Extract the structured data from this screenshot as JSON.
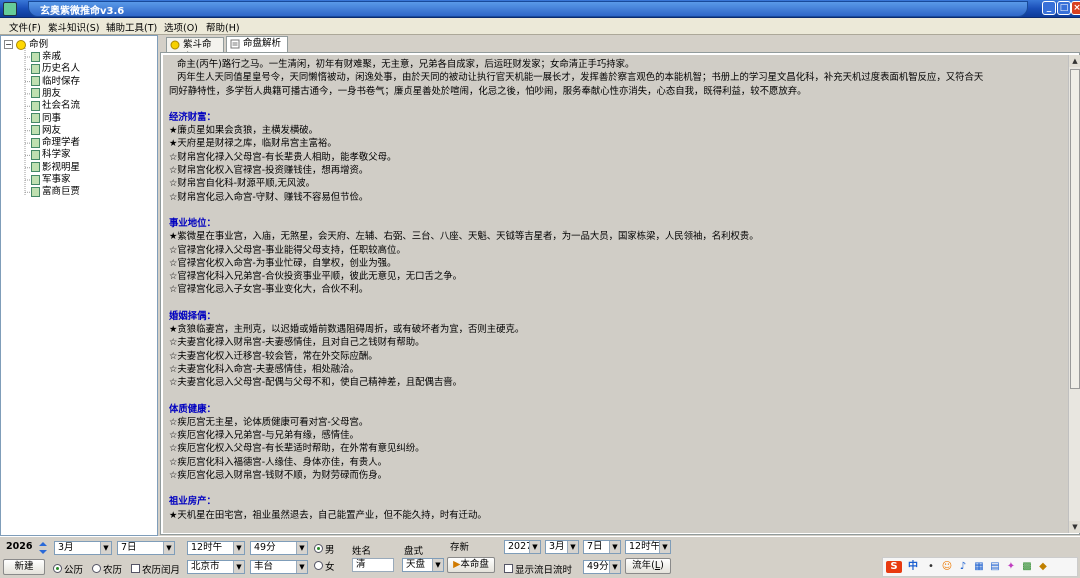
{
  "window": {
    "title": "玄奥紫微推命v3.6"
  },
  "menu": [
    "文件(F)",
    "紫斗知识(S)",
    "辅助工具(T)",
    "选项(O)",
    "帮助(H)"
  ],
  "tree": {
    "root": "命例",
    "items": [
      "亲戚",
      "历史名人",
      "临时保存",
      "朋友",
      "社会名流",
      "同事",
      "网友",
      "命理学者",
      "科学家",
      "影视明星",
      "军事家",
      "富商巨贾"
    ]
  },
  "tabs": [
    {
      "label": "紫斗命盘",
      "active": false
    },
    {
      "label": "命盘解析",
      "active": true
    }
  ],
  "doc": {
    "intro": [
      "命主(丙午)路行之马。一生清闲，初年有财难聚，无主意，兄弟各自成家，后运旺财发家；女命清正手巧持家。",
      "丙年生人天同值星皇号令，天同懒惰被动，闲逸处事，由於天同的被动让执行官天机能一展长才，发挥善於察言观色的本能机智；书册上的学习星文昌化科，补充天机过度表面机智反应，又符合天",
      "同好静特性，多学哲人典籍可播古通今，一身书卷气；廉贞星善处於喧闹，化忌之後，怕吵闹，服务奉献心性亦消失，心态自我，既得利益，较不愿放弃。"
    ],
    "sections": [
      {
        "title": "经济财富：",
        "lines": [
          "★廉贞星如果会贪狼，主横发横破。",
          "★天府星是财禄之库，临财帛宫主富裕。",
          "☆财帛宫化禄入父母宫-有长辈贵人相助，能孝敬父母。",
          "☆财帛宫化权入官禄宫-投资赚钱佳，想再增资。",
          "☆财帛宫自化科-财源平顺,无风波。",
          "☆财帛宫化忌入命宫-守财、赚钱不容易但节俭。"
        ]
      },
      {
        "title": "事业地位：",
        "lines": [
          "★紫微星在事业宫，入庙，无煞星，会天府、左辅、右弼、三台、八座、天魁、天钺等吉星者，为一品大员，国家栋梁，人民领袖，名利权贵。",
          "☆官禄宫化禄入父母宫-事业能得父母支持，任职较高位。",
          "☆官禄宫化权入命宫-为事业忙碌，自掌权，创业为强。",
          "☆官禄宫化科入兄弟宫-合伙投资事业平顺，彼此无意见，无口舌之争。",
          "☆官禄宫化忌入子女宫-事业变化大，合伙不利。"
        ]
      },
      {
        "title": "婚姻择偶：",
        "lines": [
          "★贪狼临妻宫，主刑克，以迟婚或婚前数遇阻碍周折，或有破坏者为宜，否则主硬克。",
          "☆夫妻宫化禄入财帛宫-夫妻感情佳，且对自己之钱财有帮助。",
          "☆夫妻宫化权入迁移宫-较会管，常在外交际应酬。",
          "☆夫妻宫化科入命宫-夫妻感情佳，相处融洽。",
          "☆夫妻宫化忌入父母宫-配偶与父母不和，使自己精神差，且配偶吉啬。"
        ]
      },
      {
        "title": "体质健康：",
        "lines": [
          "☆疾厄宫无主星，论体质健康可看对宫-父母宫。",
          "☆疾厄宫化禄入兄弟宫-与兄弟有缘，感情佳。",
          "☆疾厄宫化权入父母宫-有长辈适时帮助，在外常有意见纠纷。",
          "☆疾厄宫化科入福德宫-人缘佳、身体亦佳，有贵人。",
          "☆疾厄宫化忌入财帛宫-钱财不顺，为财劳碌而伤身。"
        ]
      },
      {
        "title": "祖业房产：",
        "lines": [
          "★天机星在田宅宫，祖业虽然退去，自己能置产业，但不能久持，时有迁动。"
        ]
      }
    ]
  },
  "bottom": {
    "year": "2026",
    "month": "3月",
    "day": "7日",
    "hour": "12时午",
    "minute": "49分",
    "gender_male": "男",
    "gender_female": "女",
    "gender_selected": "男",
    "name_label": "姓名",
    "name_value": "清",
    "chart_label": "盘式",
    "chart_value": "天盘",
    "save_label": "存新",
    "save_button": "本命盘",
    "new_button": "新建",
    "cal_solar": "公历",
    "cal_lunar": "农历",
    "cal_leap": "农历闰月",
    "cal_selected": "公历",
    "province": "北京市",
    "city": "丰台",
    "flow_year": "2027",
    "flow_month": "3月",
    "flow_day": "7日",
    "flow_hour": "12时午",
    "flow_minute": "49分",
    "show_flow_label": "显示流日流时",
    "flow_button": "流年",
    "flow_button_key": "L"
  },
  "ime": {
    "label": "中"
  }
}
